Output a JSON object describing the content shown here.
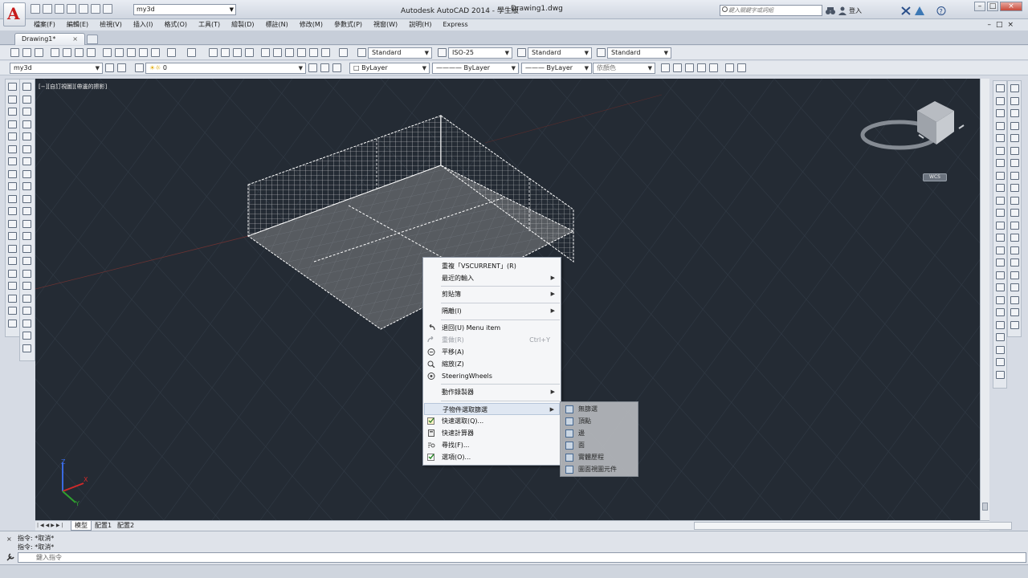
{
  "titlebar": {
    "app_title": "Autodesk AutoCAD 2014 - 學生版",
    "file_name": "Drawing1.dwg",
    "workspace": "my3d",
    "search_placeholder": "鍵入關鍵字或詞組",
    "sign_in": "登入"
  },
  "menubar": {
    "items": [
      "檔案(F)",
      "編輯(E)",
      "檢視(V)",
      "插入(I)",
      "格式(O)",
      "工具(T)",
      "繪製(D)",
      "標註(N)",
      "修改(M)",
      "參數式(P)",
      "視窗(W)",
      "說明(H)",
      "Express"
    ]
  },
  "tabs": {
    "doc_tab": "Drawing1*",
    "close": "×"
  },
  "toolbar": {
    "text_style": "Standard",
    "dim_style": "ISO-25",
    "table_style": "Standard",
    "mleader_style": "Standard",
    "workspace_dd": "my3d",
    "layer_dd": "0",
    "color_dd": "ByLayer",
    "linetype_dd": "ByLayer",
    "lineweight_dd": "ByLayer",
    "plotstyle_dd": "依顏色"
  },
  "viewport": {
    "label": "[−][自訂視圖][帶邊的擦影]",
    "wcs": "WCS",
    "axis_x": "X",
    "axis_y": "Y",
    "axis_z": "Z"
  },
  "context_menu": {
    "repeat": "重複「VSCURRENT」(R)",
    "recent_input": "最近的輸入",
    "clipboard": "剪貼簿",
    "isolate": "隔離(I)",
    "undo": "退回(U) Menu item",
    "redo": "重做(R)",
    "redo_shortcut": "Ctrl+Y",
    "pan": "平移(A)",
    "zoom": "縮放(Z)",
    "steering": "SteeringWheels",
    "action_recorder": "動作錄製器",
    "subobject_filter": "子物件選取篩選",
    "quick_select": "快速選取(Q)...",
    "quickcalc": "快速計算器",
    "find": "尋找(F)...",
    "options": "選項(O)..."
  },
  "submenu": {
    "items": [
      "無篩選",
      "頂點",
      "邊",
      "面",
      "實體歷程",
      "圖面視圖元件"
    ]
  },
  "layout_tabs": {
    "model": "模型",
    "layout1": "配置1",
    "layout2": "配置2"
  },
  "command": {
    "history": [
      "指令: *取消*",
      "指令: *取消*"
    ],
    "placeholder": "鍵入指令"
  },
  "colors": {
    "viewport_bg": "#242b34",
    "grid": "#323b46",
    "wire": "#e8e8e8",
    "solid_face": "#5b5f64",
    "accent_red": "#c61b1b"
  }
}
